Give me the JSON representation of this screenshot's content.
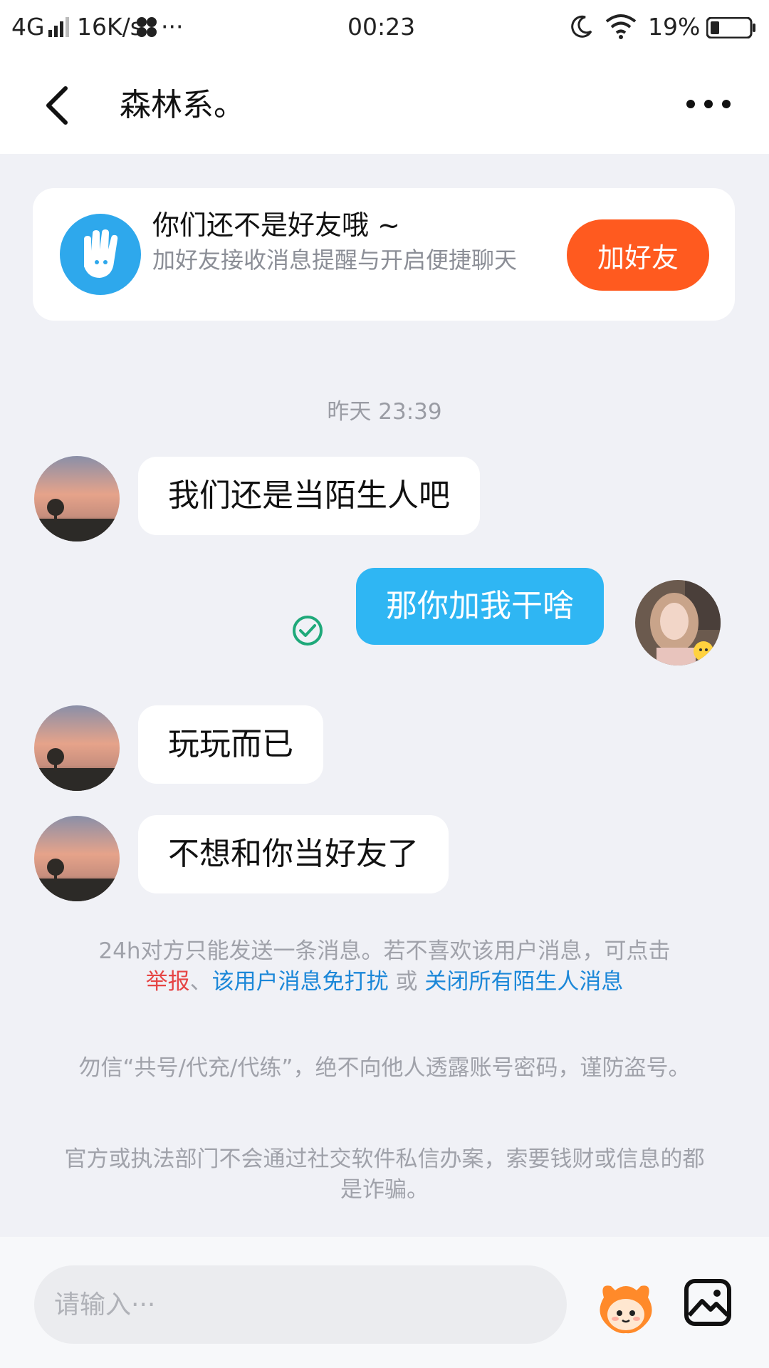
{
  "status_bar": {
    "network": "4G",
    "speed": "16K/s",
    "more_dots": "···",
    "time": "00:23",
    "battery": "19%",
    "icons": [
      "signal-icon",
      "fan-icon",
      "moon-icon",
      "wifi-icon",
      "battery-icon"
    ]
  },
  "header": {
    "back_icon": "chevron-left-icon",
    "title": "森林系。",
    "more_icon": "more-dots-icon"
  },
  "friend_card": {
    "icon": "hand-icon",
    "title": "你们还不是好友哦 ~",
    "subtitle": "加好友接收消息提醒与开启便捷聊天",
    "button_label": "加好友"
  },
  "timestamp": "昨天 23:39",
  "messages": [
    {
      "side": "in",
      "text": "我们还是当陌生人吧"
    },
    {
      "side": "out",
      "text": "那你加我干啥",
      "status": "read-check-icon"
    },
    {
      "side": "in",
      "text": "玩玩而已"
    },
    {
      "side": "in",
      "text": "不想和你当好友了"
    }
  ],
  "notice": {
    "line1": "24h对方只能发送一条消息。若不喜欢该用户消息，可点击",
    "report": "举报",
    "sep1": "、",
    "mute": "该用户消息免打扰",
    "or": " 或 ",
    "close_all": "关闭所有陌生人消息"
  },
  "warning1": "勿信“共号/代充/代练”，绝不向他人透露账号密码，谨防盗号。",
  "warning2": "官方或执法部门不会通过社交软件私信办案，索要钱财或信息的都是诈骗。",
  "input": {
    "placeholder": "请输入···",
    "emoji_icon": "emoji-face-icon",
    "image_icon": "image-icon"
  },
  "colors": {
    "accent_orange": "#ff5a1f",
    "bubble_blue": "#2fb6f3",
    "link_blue": "#1b87d8",
    "link_red": "#e64545",
    "read_green": "#1fa97a"
  }
}
